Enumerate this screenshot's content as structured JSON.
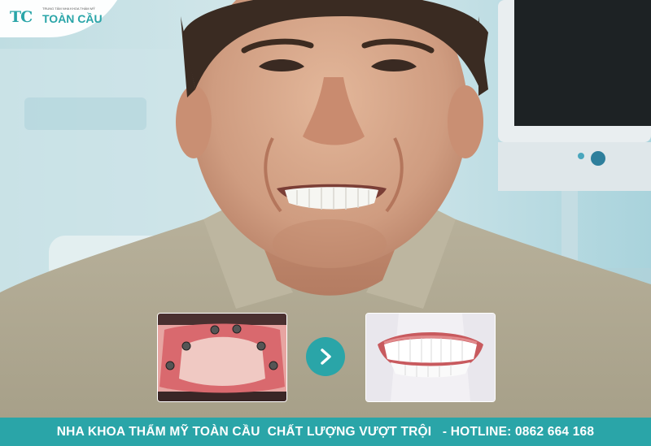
{
  "logo": {
    "mark": "TC",
    "name": "TOÀN CẦU",
    "tagline": "TRUNG TÂM NHA KHOA THẨM MỸ",
    "icon": "tooth-logo-icon"
  },
  "transition": {
    "icon": "chevron-right-icon"
  },
  "banner": {
    "text": "NHA KHOA THẨM MỸ TOÀN CẦU  CHẤT LƯỢNG VƯỢT TRỘI   - HOTLINE: 0862 664 168"
  },
  "colors": {
    "brand": "#2aa5a8",
    "banner_text": "#ffffff"
  }
}
